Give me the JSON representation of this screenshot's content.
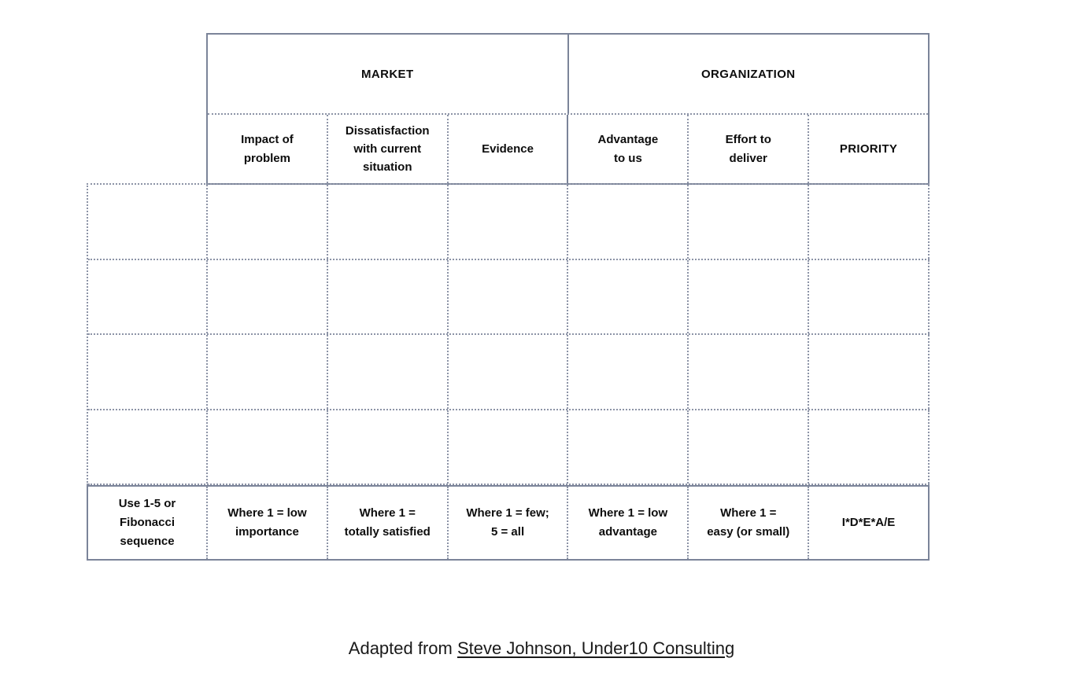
{
  "table": {
    "groups": [
      {
        "label": "MARKET"
      },
      {
        "label": "ORGANIZATION"
      }
    ],
    "columns": [
      {
        "label": "Impact of\nproblem",
        "line1": "Impact of",
        "line2": "problem"
      },
      {
        "label": "Dissatisfaction with current situation",
        "line1": "Dissatisfaction",
        "line2": "with current",
        "line3": "situation"
      },
      {
        "label": "Evidence",
        "line1": "Evidence"
      },
      {
        "label": "Advantage to us",
        "line1": "Advantage",
        "line2": "to us"
      },
      {
        "label": "Effort to deliver",
        "line1": "Effort to",
        "line2": "deliver"
      },
      {
        "label": "PRIORITY",
        "line1": "PRIORITY"
      }
    ],
    "blank_rows": [
      {
        "label": "",
        "cells": [
          "",
          "",
          "",
          "",
          "",
          ""
        ]
      },
      {
        "label": "",
        "cells": [
          "",
          "",
          "",
          "",
          "",
          ""
        ]
      },
      {
        "label": "",
        "cells": [
          "",
          "",
          "",
          "",
          "",
          ""
        ]
      },
      {
        "label": "",
        "cells": [
          "",
          "",
          "",
          "",
          "",
          ""
        ]
      }
    ],
    "legend": [
      {
        "line1": "Use 1-5 or",
        "line2": "Fibonacci",
        "line3": "sequence"
      },
      {
        "line1": "Where 1 = low",
        "line2": "importance"
      },
      {
        "line1": "Where 1 =",
        "line2": "totally satisfied"
      },
      {
        "line1": "Where 1 = few;",
        "line2": "5 = all"
      },
      {
        "line1": "Where 1 = low",
        "line2": "advantage"
      },
      {
        "line1": "Where 1 =",
        "line2": "easy (or small)"
      },
      {
        "line1": "I*D*E*A/E"
      }
    ]
  },
  "footer": {
    "prefix": "Adapted from ",
    "link": "Steve Johnson, Under10 Consulting"
  },
  "colors": {
    "solid_border": "#7b8499",
    "dotted_border": "#8c93a6",
    "text": "#0d0d0d",
    "background": "#ffffff"
  }
}
